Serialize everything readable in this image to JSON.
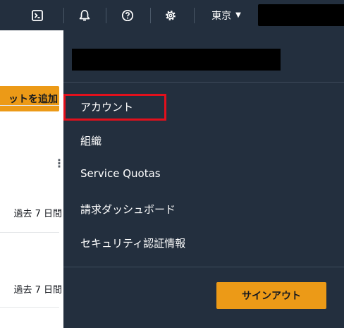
{
  "topbar": {
    "icons": [
      "cloudshell-icon",
      "notifications-bell-icon",
      "help-icon",
      "settings-gear-icon"
    ],
    "region_label": "東京",
    "region_caret": "▼"
  },
  "background": {
    "add_button_label": "ットを追加",
    "kebab": "⋮",
    "period_labels": [
      "過去 7 日間",
      "過去 7 日間"
    ]
  },
  "dropdown": {
    "items": [
      {
        "label": "アカウント",
        "highlighted": true
      },
      {
        "label": "組織"
      },
      {
        "label": "Service Quotas"
      },
      {
        "label": "請求ダッシュボード"
      },
      {
        "label": "セキュリティ認証情報"
      }
    ],
    "signout_label": "サインアウト"
  },
  "colors": {
    "nav_bg": "#232f3e",
    "accent_orange": "#ec9a17",
    "highlight_red": "#e3101c"
  }
}
